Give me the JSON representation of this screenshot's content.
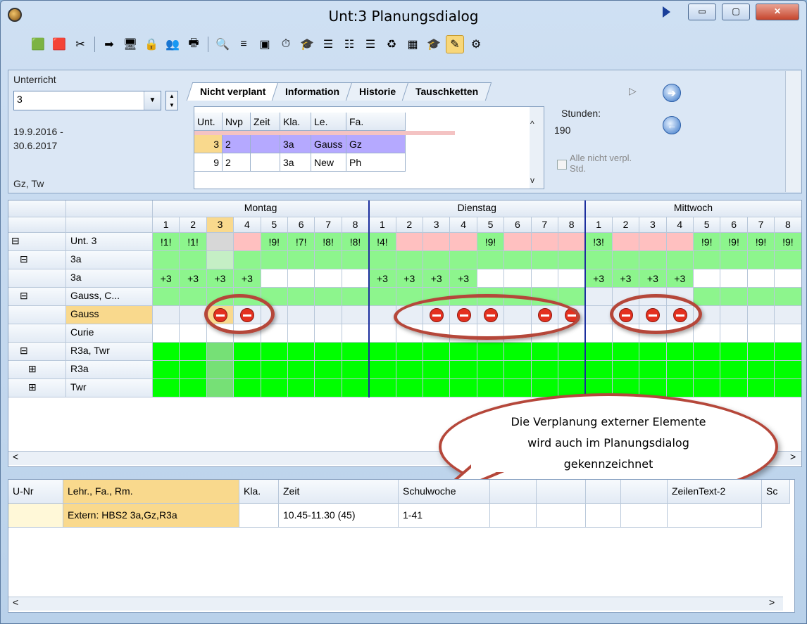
{
  "window": {
    "title": "Unt:3  Planungsdialog",
    "minimize": "▭",
    "maximize": "▢",
    "close": "✕"
  },
  "toolbar": {
    "icons": [
      "add-lesson-icon",
      "remove-lesson-icon",
      "pin-icon",
      "import-icon",
      "assign-icon",
      "lock-icon",
      "teachers-icon",
      "print-icon",
      "search-icon",
      "filter-icon",
      "copy-icon",
      "clock-icon",
      "class-add-icon",
      "class-remove-icon",
      "teacher-add-icon",
      "teacher-remove-icon",
      "cycle-icon",
      "calculator-icon",
      "cap-icon",
      "edit-icon",
      "settings-icon"
    ],
    "glyphs": [
      "🟩",
      "🟥",
      "✂",
      "➡",
      "🖥",
      "🔒",
      "👥",
      "🖶",
      "🔍",
      "≡",
      "▣",
      "⏱",
      "🎓",
      "☰",
      "☷",
      "☰",
      "♻",
      "▦",
      "🎓",
      "✎",
      "⚙"
    ]
  },
  "lesson": {
    "label": "Unterricht",
    "value": "3",
    "dates": "19.9.2016 -",
    "dates2": "30.6.2017",
    "subjects": "Gz, Tw"
  },
  "tabs": [
    "Nicht verplant",
    "Information",
    "Historie",
    "Tauschketten"
  ],
  "mini": {
    "headers": [
      "Unt.",
      "Nvp",
      "Zeit",
      "Kla.",
      "Le.",
      "Fa."
    ],
    "rows": [
      [
        "3",
        "2",
        "",
        "3a",
        "Gauss",
        "Gz"
      ],
      [
        "9",
        "2",
        "",
        "3a",
        "New",
        "Ph"
      ]
    ]
  },
  "stunden": {
    "label": "Stunden:",
    "value": "190",
    "checkbox": "Alle nicht verpl. Std."
  },
  "days": [
    "Montag",
    "Dienstag",
    "Mittwoch"
  ],
  "periods": [
    "1",
    "2",
    "3",
    "4",
    "5",
    "6",
    "7",
    "8"
  ],
  "rows": [
    {
      "label": "Unt. 3",
      "indent": 0,
      "expander": "⊟",
      "cells": [
        "!1!",
        "!1!",
        "",
        "",
        "!9!",
        "!7!",
        "!8!",
        "!8!",
        "!4!",
        "",
        "",
        "",
        "!9!",
        "",
        "",
        "",
        "!3!",
        "",
        "",
        "",
        "!9!",
        "!9!",
        "!9!",
        "!9!"
      ]
    },
    {
      "label": "3a",
      "indent": 1,
      "expander": "⊟",
      "cells": []
    },
    {
      "label": "3a",
      "indent": 2,
      "expander": "",
      "cells": [
        "+3",
        "+3",
        "+3",
        "+3",
        "",
        "",
        "",
        "",
        "+3",
        "+3",
        "+3",
        "+3",
        "",
        "",
        "",
        "",
        "+3",
        "+3",
        "+3",
        "+3",
        "",
        "",
        "",
        ""
      ]
    },
    {
      "label": "Gauss, C...",
      "indent": 1,
      "expander": "⊟",
      "cells": []
    },
    {
      "label": "Gauss",
      "indent": 2,
      "expander": "",
      "cells": []
    },
    {
      "label": "Curie",
      "indent": 2,
      "expander": "",
      "cells": []
    },
    {
      "label": "R3a, Twr",
      "indent": 1,
      "expander": "⊟",
      "cells": []
    },
    {
      "label": "R3a",
      "indent": 2,
      "expander": "⊞",
      "cells": []
    },
    {
      "label": "Twr",
      "indent": 2,
      "expander": "⊞",
      "cells": []
    }
  ],
  "callout": [
    "Die Verplanung externer Elemente",
    "wird auch im Planungsdialog",
    "gekennzeichnet"
  ],
  "bottom": {
    "headers": [
      "U-Nr",
      "Lehr., Fa., Rm.",
      "Kla.",
      "Zeit",
      "Schulwoche",
      "",
      "",
      "",
      "",
      "ZeilenText-2",
      "Sc"
    ],
    "row": [
      "",
      "Extern: HBS2 3a,Gz,R3a",
      "",
      "10.45-11.30 (45)",
      "1-41"
    ]
  },
  "colors": {
    "green": "#00ff00",
    "lightgreen": "#8df58d",
    "pink": "#ffc0c0",
    "gray": "#d7d7d7",
    "selected": "#f9d98d",
    "lilac": "#b5a9ff"
  }
}
